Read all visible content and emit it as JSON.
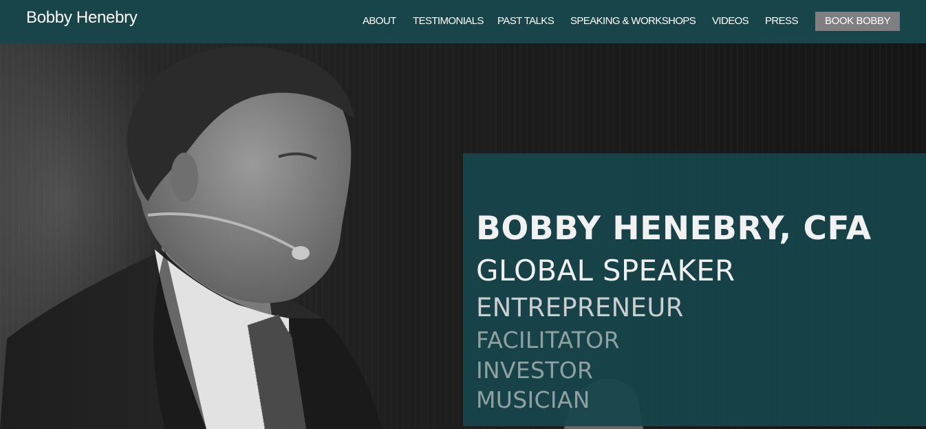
{
  "header": {
    "brand": "Bobby Henebry",
    "nav": {
      "about": "ABOUT",
      "testimonials": "TESTIMONIALS",
      "past_talks": "PAST TALKS",
      "speaking_workshops": "SPEAKING & WORKSHOPS",
      "videos": "VIDEOS",
      "press": "PRESS",
      "book": "BOOK BOBBY"
    }
  },
  "hero": {
    "photo": "speaker-with-headset-microphone",
    "name": "BOBBY HENEBRY, CFA",
    "roles": [
      "GLOBAL SPEAKER",
      "ENTREPRENEUR",
      "FACILITATOR",
      "INVESTOR",
      "MUSICIAN"
    ]
  },
  "colors": {
    "header_bg": "#17454a",
    "panel_bg": "#17454a",
    "cta_bg": "#7f7f7f",
    "hero_bg": "#151515"
  }
}
